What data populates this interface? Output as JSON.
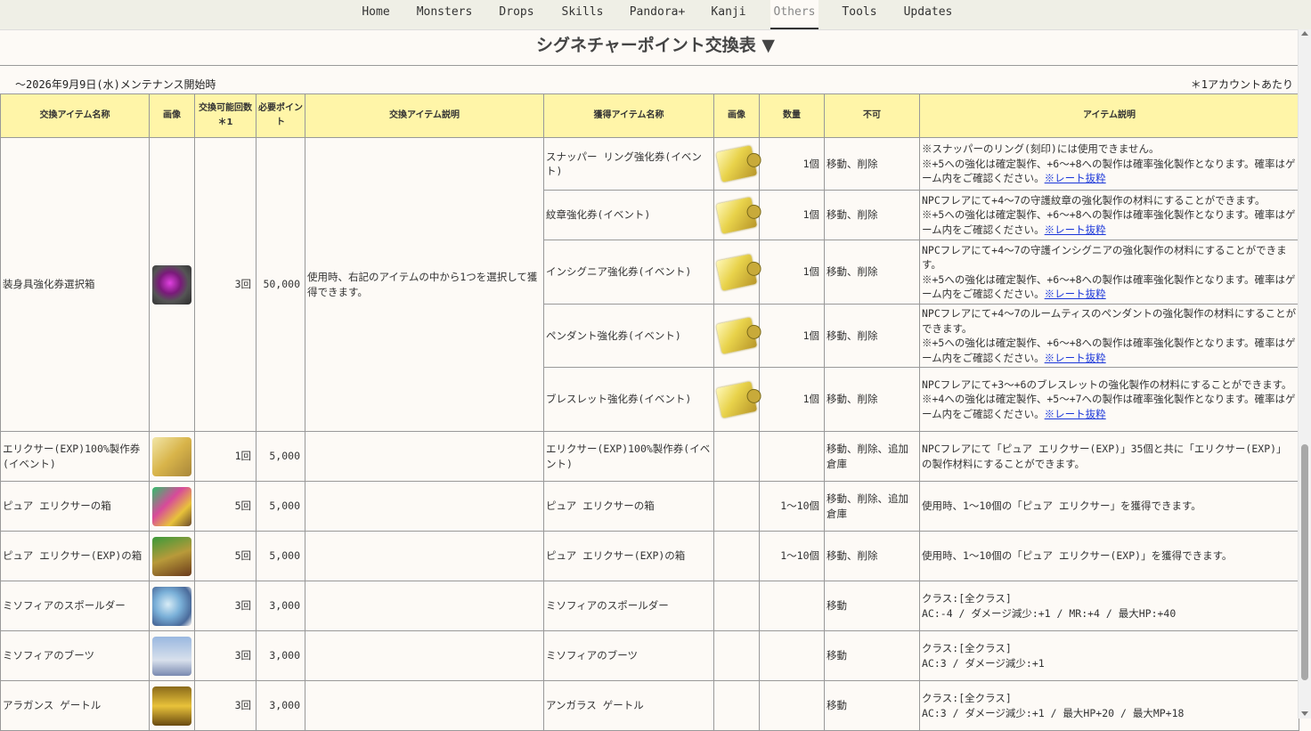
{
  "nav": [
    {
      "label": "Home"
    },
    {
      "label": "Monsters"
    },
    {
      "label": "Drops"
    },
    {
      "label": "Skills"
    },
    {
      "label": "Pandora+"
    },
    {
      "label": "Kanji"
    },
    {
      "label": "Others",
      "active": true
    },
    {
      "label": "Tools"
    },
    {
      "label": "Updates"
    }
  ],
  "title": "シグネチャーポイント交換表 ▼",
  "notes": {
    "left": "～2026年9月9日(水)メンテナンス開始時",
    "right": "＊1アカウントあたり"
  },
  "headers": {
    "item_name": "交換アイテム名称",
    "image": "画像",
    "limit": "交換可能回数＊1",
    "points": "必要ポイント",
    "desc": "交換アイテム説明",
    "got_name": "獲得アイテム名称",
    "got_image": "画像",
    "qty": "数量",
    "restrict": "不可",
    "got_desc": "アイテム説明"
  },
  "link_label": "※レート抜粋",
  "groups": [
    {
      "name": "装身具強化券選択箱",
      "icon": "purple-chest-icon",
      "limit": "3回",
      "points": "50,000",
      "desc": "使用時、右記のアイテムの中から1つを選択して獲得できます。",
      "subs": [
        {
          "name": "スナッパー リング強化券(イベント)",
          "icon": "scroll-icon",
          "qty": "1個",
          "restrict": "移動、削除",
          "desc": "※スナッパーのリング(刻印)には使用できません。\n※+5への強化は確定製作、+6～+8への製作は確率強化製作となります。確率はゲーム内をご確認ください。",
          "link": true
        },
        {
          "name": "紋章強化券(イベント)",
          "icon": "scroll-icon",
          "qty": "1個",
          "restrict": "移動、削除",
          "desc": "NPCフレアにて+4～7の守護紋章の強化製作の材料にすることができます。\n※+5への強化は確定製作、+6～+8への製作は確率強化製作となります。確率はゲーム内をご確認ください。",
          "link": true
        },
        {
          "name": "インシグニア強化券(イベント)",
          "icon": "scroll-icon",
          "qty": "1個",
          "restrict": "移動、削除",
          "desc": "NPCフレアにて+4～7の守護インシグニアの強化製作の材料にすることができます。\n※+5への強化は確定製作、+6～+8への製作は確率強化製作となります。確率はゲーム内をご確認ください。",
          "link": true
        },
        {
          "name": "ペンダント強化券(イベント)",
          "icon": "scroll-icon",
          "qty": "1個",
          "restrict": "移動、削除",
          "desc": "NPCフレアにて+4～7のルームティスのペンダントの強化製作の材料にすることができます。\n※+5への強化は確定製作、+6～+8への製作は確率強化製作となります。確率はゲーム内をご確認ください。",
          "link": true
        },
        {
          "name": "ブレスレット強化券(イベント)",
          "icon": "scroll-icon",
          "qty": "1個",
          "restrict": "移動、削除",
          "desc": "NPCフレアにて+3～+6のブレスレットの強化製作の材料にすることができます。\n※+4への強化は確定製作、+5～+7への製作は確率強化製作となります。確率はゲーム内をご確認ください。",
          "link": true
        }
      ]
    }
  ],
  "rows": [
    {
      "name": "エリクサー(EXP)100%製作券(イベント)",
      "icon": "elixir-ticket-icon",
      "limit": "1回",
      "points": "5,000",
      "got_name": "エリクサー(EXP)100%製作券(イベント)",
      "qty": "",
      "restrict": "移動、削除、追加倉庫",
      "desc": "NPCフレアにて「ピュア エリクサー(EXP)」35個と共に「エリクサー(EXP)」の製作材料にすることができます。"
    },
    {
      "name": "ピュア エリクサーの箱",
      "icon": "rainbow-chest-icon",
      "limit": "5回",
      "points": "5,000",
      "got_name": "ピュア エリクサーの箱",
      "qty": "1～10個",
      "restrict": "移動、削除、追加倉庫",
      "desc": "使用時、1～10個の「ピュア エリクサー」を獲得できます。"
    },
    {
      "name": "ピュア エリクサー(EXP)の箱",
      "icon": "green-chest-icon",
      "limit": "5回",
      "points": "5,000",
      "got_name": "ピュア エリクサー(EXP)の箱",
      "qty": "1～10個",
      "restrict": "移動、削除",
      "desc": "使用時、1～10個の「ピュア エリクサー(EXP)」を獲得できます。"
    },
    {
      "name": "ミソフィアのスポールダー",
      "icon": "shoulder-armor-icon",
      "limit": "3回",
      "points": "3,000",
      "got_name": "ミソフィアのスポールダー",
      "qty": "",
      "restrict": "移動",
      "desc": "クラス:[全クラス]\nAC:-4 / ダメージ減少:+1 / MR:+4 / 最大HP:+40"
    },
    {
      "name": "ミソフィアのブーツ",
      "icon": "boots-icon",
      "limit": "3回",
      "points": "3,000",
      "got_name": "ミソフィアのブーツ",
      "qty": "",
      "restrict": "移動",
      "desc": "クラス:[全クラス]\nAC:3 / ダメージ減少:+1"
    },
    {
      "name": "アラガンス ゲートル",
      "icon": "gaiter-icon",
      "limit": "3回",
      "points": "3,000",
      "got_name": "アンガラス ゲートル",
      "qty": "",
      "restrict": "移動",
      "desc": "クラス:[全クラス]\nAC:3 / ダメージ減少:+1 / 最大HP+20 / 最大MP+18"
    }
  ]
}
